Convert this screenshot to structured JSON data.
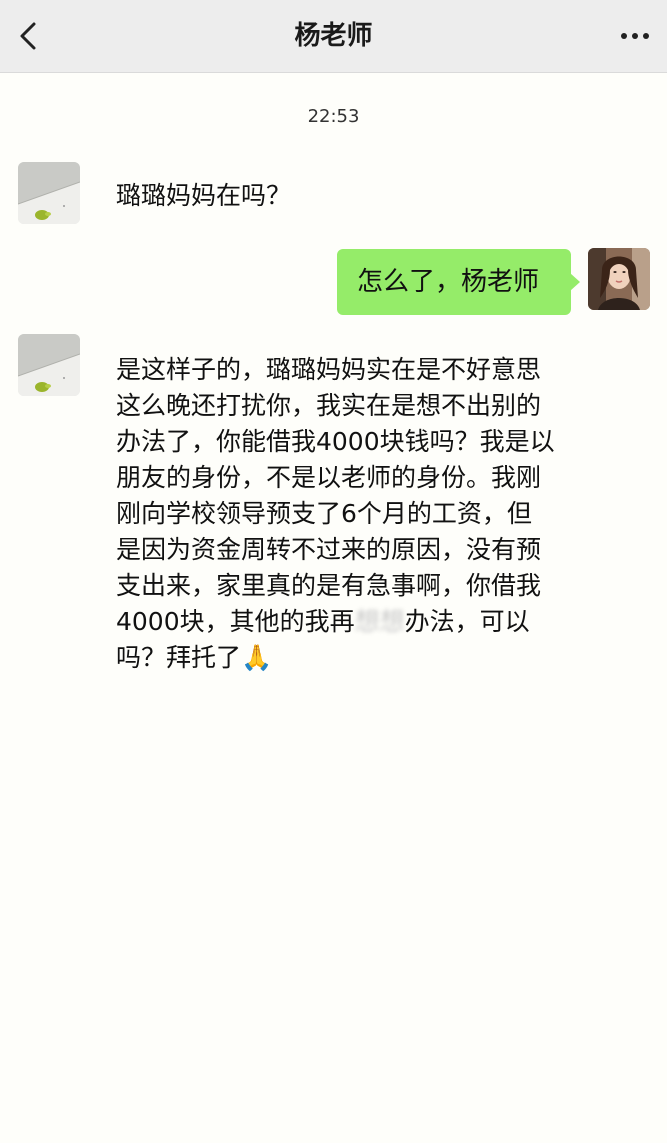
{
  "header": {
    "title": "杨老师",
    "back_icon": "chevron-left-icon",
    "more_icon": "more-dots-icon"
  },
  "chat": {
    "timestamp": "22:53",
    "messages": [
      {
        "side": "left",
        "text": "璐璐妈妈在吗？"
      },
      {
        "side": "right",
        "text": "怎么了，杨老师"
      },
      {
        "side": "left",
        "text_before_blur": "是这样子的，璐璐妈妈实在是不好意思这么晚还打扰你，我实在是想不出别的办法了，你能借我4000块钱吗？我是以朋友的身份，不是以老师的身份。我刚刚向学校领导预支了6个月的工资，但是因为资金周转不过来的原因，没有预支出来，家里真的是有急事啊，你借我4000块，其他的我再",
        "blurred_text": "想想",
        "text_after_blur": "办法，可以吗？拜托了🙏"
      }
    ]
  },
  "colors": {
    "header_bg": "#ededed",
    "chat_bg": "#fefefa",
    "sent_bubble": "#95ec69"
  }
}
